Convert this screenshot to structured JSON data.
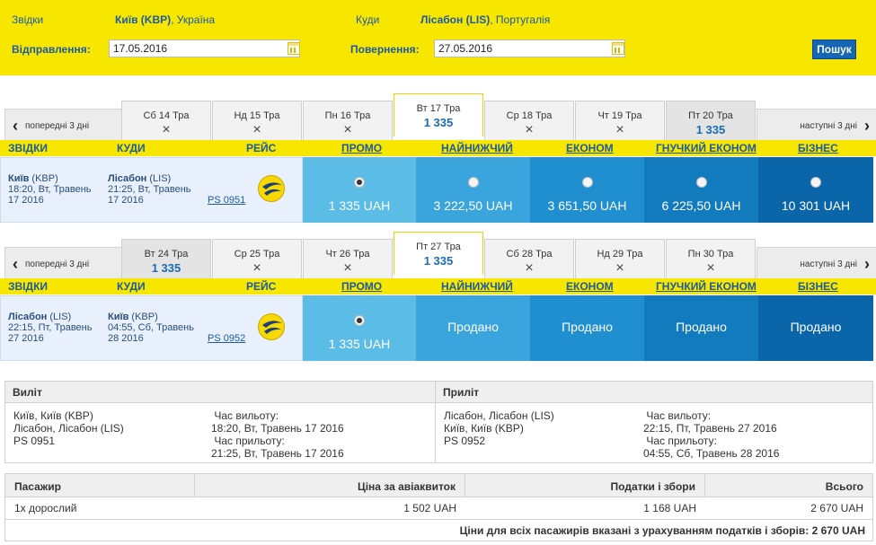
{
  "search": {
    "from_label": "Звідки",
    "from_city": "Київ (KBP)",
    "from_country": ", Україна",
    "to_label": "Куди",
    "to_city": "Лісабон (LIS)",
    "to_country": ", Португалія",
    "depart_label": "Відправлення:",
    "depart_date": "17.05.2016",
    "return_label": "Повернення:",
    "return_date": "27.05.2016",
    "search_button": "Пошук"
  },
  "nav": {
    "prev": "попередні 3 дні",
    "next": "наступні 3 дні"
  },
  "columns": {
    "from": "ЗВІДКИ",
    "to": "КУДИ",
    "flight": "РЕЙС",
    "promo": "ПРОМО",
    "lowest": "НАЙНИЖЧИЙ",
    "economy": "ЕКОНОМ",
    "flex": "ГНУЧКИЙ ЕКОНОМ",
    "business": "БІЗНЕС"
  },
  "outbound": {
    "tabs": [
      {
        "label": "Сб 14 Тра",
        "price": ""
      },
      {
        "label": "Нд 15 Тра",
        "price": ""
      },
      {
        "label": "Пн 16 Тра",
        "price": ""
      },
      {
        "label": "Вт 17 Тра",
        "price": "1 335"
      },
      {
        "label": "Ср 18 Тра",
        "price": ""
      },
      {
        "label": "Чт 19 Тра",
        "price": ""
      },
      {
        "label": "Пт 20 Тра",
        "price": "1 335"
      }
    ],
    "from_city": "Київ",
    "from_code": " (KBP)",
    "from_time": "18:20, Вт, Травень",
    "from_year": "17 2016",
    "to_city": "Лісабон",
    "to_code": " (LIS)",
    "to_time": "21:25, Вт, Травень",
    "to_year": "17 2016",
    "flight_no": "PS 0951",
    "fares": [
      "1 335 UAH",
      "3 222,50 UAH",
      "3 651,50 UAH",
      "6 225,50 UAH",
      "10 301 UAH"
    ]
  },
  "inbound": {
    "tabs": [
      {
        "label": "Вт 24 Тра",
        "price": "1 335"
      },
      {
        "label": "Ср 25 Тра",
        "price": ""
      },
      {
        "label": "Чт 26 Тра",
        "price": ""
      },
      {
        "label": "Пт 27 Тра",
        "price": "1 335"
      },
      {
        "label": "Сб 28 Тра",
        "price": ""
      },
      {
        "label": "Нд 29 Тра",
        "price": ""
      },
      {
        "label": "Пн 30 Тра",
        "price": ""
      }
    ],
    "from_city": "Лісабон",
    "from_code": " (LIS)",
    "from_time": "22:15, Пт, Травень",
    "from_year": "27 2016",
    "to_city": "Київ",
    "to_code": " (KBP)",
    "to_time": "04:55, Сб, Травень",
    "to_year": "28 2016",
    "flight_no": "PS 0952",
    "fares": [
      "1 335 UAH",
      "Продано",
      "Продано",
      "Продано",
      "Продано"
    ]
  },
  "summary": {
    "depart_title": "Виліт",
    "arrive_title": "Приліт",
    "out_route1": "Київ, Київ (KBP)",
    "out_route2": "Лісабон, Лісабон (LIS)",
    "out_flight": "PS 0951",
    "dep_label": "Час вильоту:",
    "out_dep": "18:20, Вт, Травень 17 2016",
    "arr_label": "Час прильоту:",
    "out_arr": "21:25, Вт, Травень 17 2016",
    "in_route1": "Лісабон, Лісабон (LIS)",
    "in_route2": "Київ, Київ (KBP)",
    "in_flight": "PS 0952",
    "in_dep": "22:15, Пт, Травень 27 2016",
    "in_arr": "04:55, Сб, Травень 28 2016"
  },
  "price_table": {
    "headers": [
      "Пасажир",
      "Ціна за авіаквиток",
      "Податки і збори",
      "Всього"
    ],
    "row": [
      "1х дорослий",
      "1 502 UAH",
      "1 168 UAH",
      "2 670 UAH"
    ],
    "total": "Ціни для всіх пасажирів вказані з урахуванням податків і зборів: 2 670 UAH"
  },
  "colors": {
    "brand_yellow": "#f7e600",
    "link_blue": "#1a5aa6",
    "fare_gradient": [
      "#5bbde6",
      "#3aa5dc",
      "#1f8fcf",
      "#127bbd",
      "#0a66a8"
    ]
  }
}
